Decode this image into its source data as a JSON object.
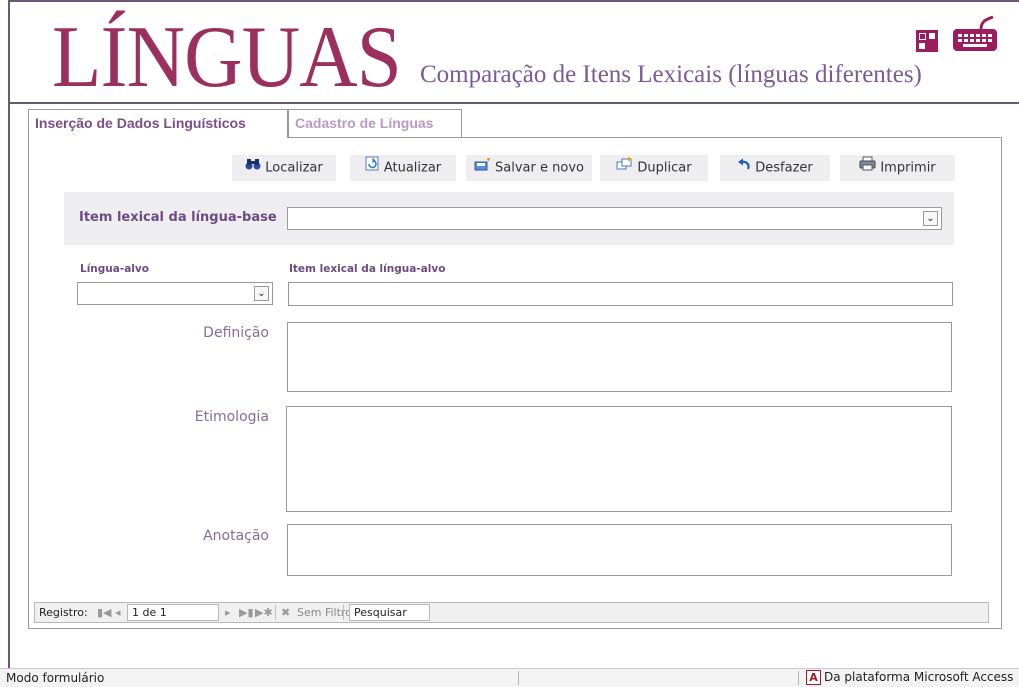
{
  "header": {
    "logo": "LÍNGUAS",
    "subtitle": "Comparação de Itens Lexicais (línguas diferentes)",
    "icons": [
      "layout-grid-icon",
      "keyboard-icon"
    ],
    "brand_color": "#9b2f5d",
    "accent_color": "#7b5a95"
  },
  "tabs": [
    {
      "label": "Inserção de Dados Linguísticos",
      "active": true
    },
    {
      "label": "Cadastro de Línguas",
      "active": false
    }
  ],
  "toolbar": {
    "find_label": "Localizar",
    "refresh_label": "Atualizar",
    "save_new_label": "Salvar e novo",
    "duplicate_label": "Duplicar",
    "undo_label": "Desfazer",
    "print_label": "Imprimir"
  },
  "form": {
    "base_item_label": "Item lexical da língua-base",
    "base_item_value": "",
    "target_language_label": "Língua-alvo",
    "target_language_value": "",
    "target_item_label": "Item lexical da língua-alvo",
    "target_item_value": "",
    "definition_label": "Definição",
    "definition_value": "",
    "etymology_label": "Etimologia",
    "etymology_value": "",
    "annotation_label": "Anotação",
    "annotation_value": ""
  },
  "record_nav": {
    "label": "Registro:",
    "current": "1 de 1",
    "filter_label": "Sem Filtro",
    "search_placeholder": "Pesquisar"
  },
  "status_bar": {
    "mode": "Modo formulário",
    "platform": "Da plataforma Microsoft Access"
  }
}
